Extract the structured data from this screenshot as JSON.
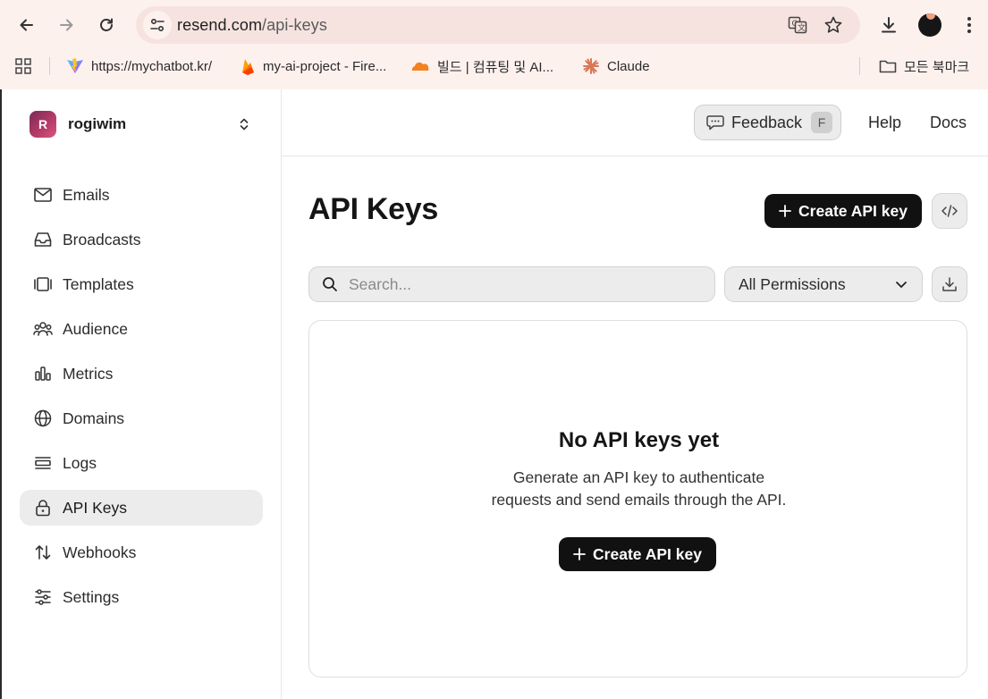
{
  "browser": {
    "url_domain": "resend.com",
    "url_path": "/api-keys",
    "bookmarks": [
      {
        "label": "https://mychatbot.kr/",
        "icon": "vite-logo-icon"
      },
      {
        "label": "my-ai-project - Fire...",
        "icon": "firebase-logo-icon"
      },
      {
        "label": "빌드 | 컴퓨팅 및 AI...",
        "icon": "cloudflare-logo-icon"
      },
      {
        "label": "Claude",
        "icon": "claude-logo-icon"
      }
    ],
    "all_bookmarks_label": "모든 북마크"
  },
  "team": {
    "initial": "R",
    "name": "rogiwim"
  },
  "sidebar": {
    "items": [
      {
        "label": "Emails",
        "icon": "mail-icon"
      },
      {
        "label": "Broadcasts",
        "icon": "inbox-icon"
      },
      {
        "label": "Templates",
        "icon": "templates-icon"
      },
      {
        "label": "Audience",
        "icon": "users-icon"
      },
      {
        "label": "Metrics",
        "icon": "bar-chart-icon"
      },
      {
        "label": "Domains",
        "icon": "globe-icon"
      },
      {
        "label": "Logs",
        "icon": "logs-icon"
      },
      {
        "label": "API Keys",
        "icon": "lock-icon",
        "active": true
      },
      {
        "label": "Webhooks",
        "icon": "arrows-updown-icon"
      },
      {
        "label": "Settings",
        "icon": "sliders-icon"
      }
    ]
  },
  "header": {
    "feedback_label": "Feedback",
    "feedback_shortcut": "F",
    "help_label": "Help",
    "docs_label": "Docs"
  },
  "main": {
    "title": "API Keys",
    "create_label": "Create API key",
    "search_placeholder": "Search...",
    "permissions_selected": "All Permissions",
    "empty_title": "No API keys yet",
    "empty_desc_line1": "Generate an API key to authenticate",
    "empty_desc_line2": "requests and send emails through the API.",
    "empty_create_label": "Create API key"
  },
  "colors": {
    "chrome_bg": "#fdf1ee",
    "primary_button": "#111111",
    "active_nav": "#ececec"
  }
}
